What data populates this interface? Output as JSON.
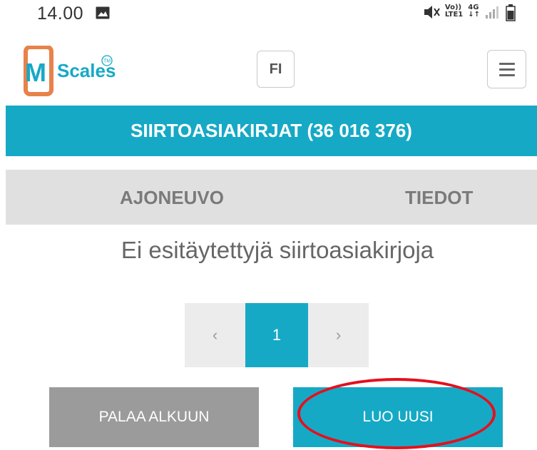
{
  "status_bar": {
    "time": "14.00",
    "net_top": "Vo))",
    "net_bottom": "LTE1",
    "gen_top": "4G",
    "gen_bottom": "↓↑"
  },
  "header": {
    "logo_m": "M",
    "logo_text": "Scales",
    "logo_tm": "TM",
    "lang_label": "FI"
  },
  "title_bar": {
    "title": "SIIRTOASIAKIRJAT (36 016 376)"
  },
  "tabs": [
    {
      "label": "AJONEUVO"
    },
    {
      "label": "TIEDOT"
    }
  ],
  "empty_message": "Ei esitäytettyjä siirtoasiakirjoja",
  "pagination": {
    "prev_label": "‹",
    "current_page": "1",
    "next_label": "›"
  },
  "actions": {
    "back_label": "PALAA ALKUUN",
    "new_label": "LUO UUSI"
  },
  "colors": {
    "accent": "#16a9c6",
    "secondary_button": "#9b9b9b",
    "highlight": "#e4101d",
    "logo_orange": "#e8824a"
  }
}
